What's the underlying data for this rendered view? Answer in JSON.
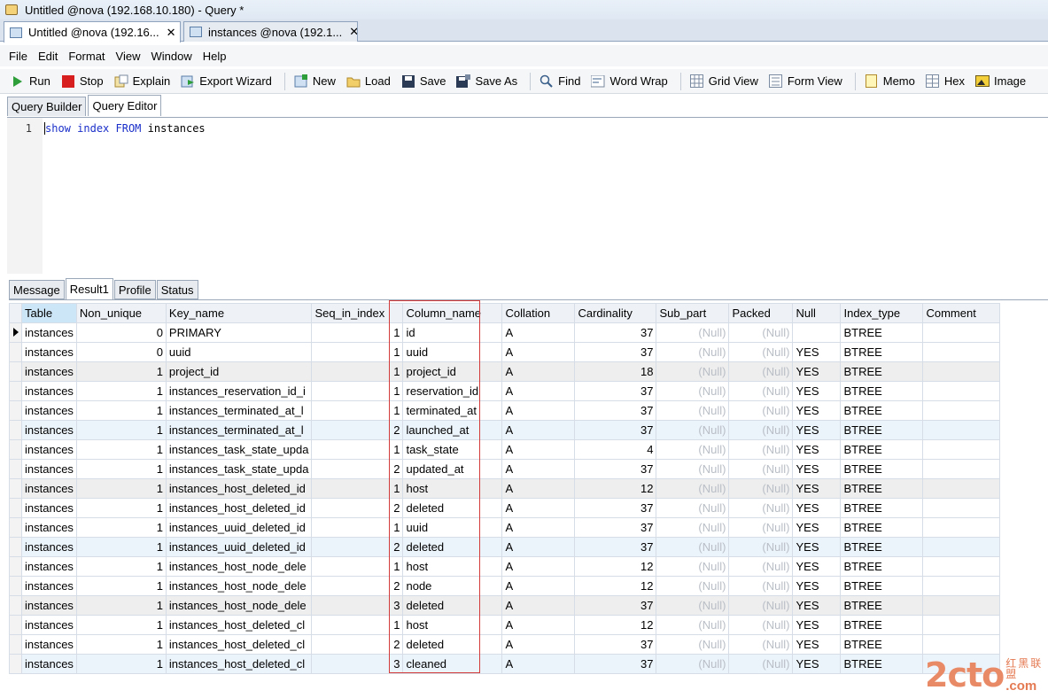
{
  "window": {
    "title": "Untitled @nova (192.168.10.180) - Query *"
  },
  "doc_tabs": [
    {
      "label": "Untitled @nova (192.16...",
      "close": "✕",
      "active": true
    },
    {
      "label": "instances @nova (192.1...",
      "close": "✕",
      "active": false
    }
  ],
  "menu": [
    "File",
    "Edit",
    "Format",
    "View",
    "Window",
    "Help"
  ],
  "toolbar": {
    "run": "Run",
    "stop": "Stop",
    "explain": "Explain",
    "export_wizard": "Export Wizard",
    "new": "New",
    "load": "Load",
    "save": "Save",
    "save_as": "Save As",
    "find": "Find",
    "word_wrap": "Word Wrap",
    "grid_view": "Grid View",
    "form_view": "Form View",
    "memo": "Memo",
    "hex": "Hex",
    "image": "Image"
  },
  "query_tabs": [
    "Query Builder",
    "Query Editor"
  ],
  "editor": {
    "line_number": "1",
    "tokens": [
      {
        "text": "show",
        "kw": true
      },
      {
        "text": " ",
        "kw": false
      },
      {
        "text": "index",
        "kw": true
      },
      {
        "text": " ",
        "kw": false
      },
      {
        "text": "FROM",
        "kw": true
      },
      {
        "text": " instances",
        "kw": false
      }
    ]
  },
  "result_tabs": [
    "Message",
    "Result1",
    "Profile",
    "Status"
  ],
  "grid": {
    "columns": [
      "Table",
      "Non_unique",
      "Key_name",
      "Seq_in_index",
      "Column_name",
      "Collation",
      "Cardinality",
      "Sub_part",
      "Packed",
      "Null",
      "Index_type",
      "Comment"
    ],
    "rows": [
      [
        "instances",
        "0",
        "PRIMARY",
        "1",
        "id",
        "A",
        "37",
        "(Null)",
        "(Null)",
        "",
        "BTREE",
        ""
      ],
      [
        "instances",
        "0",
        "uuid",
        "1",
        "uuid",
        "A",
        "37",
        "(Null)",
        "(Null)",
        "YES",
        "BTREE",
        ""
      ],
      [
        "instances",
        "1",
        "project_id",
        "1",
        "project_id",
        "A",
        "18",
        "(Null)",
        "(Null)",
        "YES",
        "BTREE",
        ""
      ],
      [
        "instances",
        "1",
        "instances_reservation_id_i",
        "1",
        "reservation_id",
        "A",
        "37",
        "(Null)",
        "(Null)",
        "YES",
        "BTREE",
        ""
      ],
      [
        "instances",
        "1",
        "instances_terminated_at_l",
        "1",
        "terminated_at",
        "A",
        "37",
        "(Null)",
        "(Null)",
        "YES",
        "BTREE",
        ""
      ],
      [
        "instances",
        "1",
        "instances_terminated_at_l",
        "2",
        "launched_at",
        "A",
        "37",
        "(Null)",
        "(Null)",
        "YES",
        "BTREE",
        ""
      ],
      [
        "instances",
        "1",
        "instances_task_state_upda",
        "1",
        "task_state",
        "A",
        "4",
        "(Null)",
        "(Null)",
        "YES",
        "BTREE",
        ""
      ],
      [
        "instances",
        "1",
        "instances_task_state_upda",
        "2",
        "updated_at",
        "A",
        "37",
        "(Null)",
        "(Null)",
        "YES",
        "BTREE",
        ""
      ],
      [
        "instances",
        "1",
        "instances_host_deleted_id",
        "1",
        "host",
        "A",
        "12",
        "(Null)",
        "(Null)",
        "YES",
        "BTREE",
        ""
      ],
      [
        "instances",
        "1",
        "instances_host_deleted_id",
        "2",
        "deleted",
        "A",
        "37",
        "(Null)",
        "(Null)",
        "YES",
        "BTREE",
        ""
      ],
      [
        "instances",
        "1",
        "instances_uuid_deleted_id",
        "1",
        "uuid",
        "A",
        "37",
        "(Null)",
        "(Null)",
        "YES",
        "BTREE",
        ""
      ],
      [
        "instances",
        "1",
        "instances_uuid_deleted_id",
        "2",
        "deleted",
        "A",
        "37",
        "(Null)",
        "(Null)",
        "YES",
        "BTREE",
        ""
      ],
      [
        "instances",
        "1",
        "instances_host_node_dele",
        "1",
        "host",
        "A",
        "12",
        "(Null)",
        "(Null)",
        "YES",
        "BTREE",
        ""
      ],
      [
        "instances",
        "1",
        "instances_host_node_dele",
        "2",
        "node",
        "A",
        "12",
        "(Null)",
        "(Null)",
        "YES",
        "BTREE",
        ""
      ],
      [
        "instances",
        "1",
        "instances_host_node_dele",
        "3",
        "deleted",
        "A",
        "37",
        "(Null)",
        "(Null)",
        "YES",
        "BTREE",
        ""
      ],
      [
        "instances",
        "1",
        "instances_host_deleted_cl",
        "1",
        "host",
        "A",
        "12",
        "(Null)",
        "(Null)",
        "YES",
        "BTREE",
        ""
      ],
      [
        "instances",
        "1",
        "instances_host_deleted_cl",
        "2",
        "deleted",
        "A",
        "37",
        "(Null)",
        "(Null)",
        "YES",
        "BTREE",
        ""
      ],
      [
        "instances",
        "1",
        "instances_host_deleted_cl",
        "3",
        "cleaned",
        "A",
        "37",
        "(Null)",
        "(Null)",
        "YES",
        "BTREE",
        ""
      ]
    ]
  },
  "watermark": {
    "main": "2cto",
    "cn": "红黑联盟",
    "com": ".com"
  },
  "colors": {
    "keyword": "#1a2fc9",
    "highlight_box": "#d33a3a",
    "null_text": "#b9bec6",
    "header_selected": "#cde6f7",
    "watermark": "#e98a67"
  }
}
